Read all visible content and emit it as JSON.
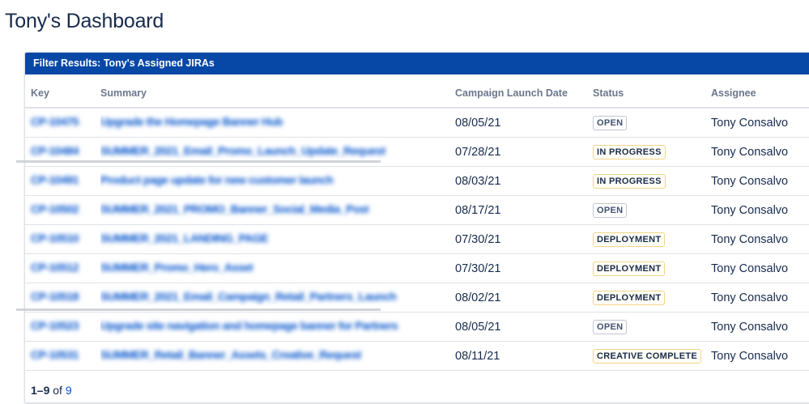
{
  "page": {
    "title": "Tony's Dashboard"
  },
  "panel": {
    "header": "Filter Results: Tony's Assigned JIRAs"
  },
  "table": {
    "columns": [
      "Key",
      "Summary",
      "Campaign Launch Date",
      "Status",
      "Assignee"
    ],
    "rows": [
      {
        "key": "CP-10475",
        "summary": "Upgrade the Homepage Banner Hub",
        "date": "08/05/21",
        "status": "OPEN",
        "assignee": "Tony Consalvo"
      },
      {
        "key": "CP-10484",
        "summary": "SUMMER_2021_Email_Promo_Launch_Update_Request",
        "date": "07/28/21",
        "status": "IN PROGRESS",
        "assignee": "Tony Consalvo"
      },
      {
        "key": "CP-10491",
        "summary": "Product page update for new customer launch",
        "date": "08/03/21",
        "status": "IN PROGRESS",
        "assignee": "Tony Consalvo"
      },
      {
        "key": "CP-10502",
        "summary": "SUMMER_2021_PROMO_Banner_Social_Media_Post",
        "date": "08/17/21",
        "status": "OPEN",
        "assignee": "Tony Consalvo"
      },
      {
        "key": "CP-10510",
        "summary": "SUMMER_2021_LANDING_PAGE",
        "date": "07/30/21",
        "status": "DEPLOYMENT",
        "assignee": "Tony Consalvo"
      },
      {
        "key": "CP-10512",
        "summary": "SUMMER_Promo_Hero_Asset",
        "date": "07/30/21",
        "status": "DEPLOYMENT",
        "assignee": "Tony Consalvo"
      },
      {
        "key": "CP-10518",
        "summary": "SUMMER_2021_Email_Campaign_Retail_Partners_Launch",
        "date": "08/02/21",
        "status": "DEPLOYMENT",
        "assignee": "Tony Consalvo"
      },
      {
        "key": "CP-10523",
        "summary": "Upgrade site navigation and homepage banner for Partners",
        "date": "08/05/21",
        "status": "OPEN",
        "assignee": "Tony Consalvo"
      },
      {
        "key": "CP-10531",
        "summary": "SUMMER_Retail_Banner_Assets_Creative_Request",
        "date": "08/11/21",
        "status": "CREATIVE COMPLETE",
        "assignee": "Tony Consalvo"
      }
    ]
  },
  "pagination": {
    "range": "1–9",
    "of_label": "of",
    "total": "9"
  },
  "colors": {
    "header_bg": "#0747a6",
    "link": "#0052cc",
    "lozenge_default_border": "#c1c7d0",
    "lozenge_moved_border": "#f1d58a"
  }
}
